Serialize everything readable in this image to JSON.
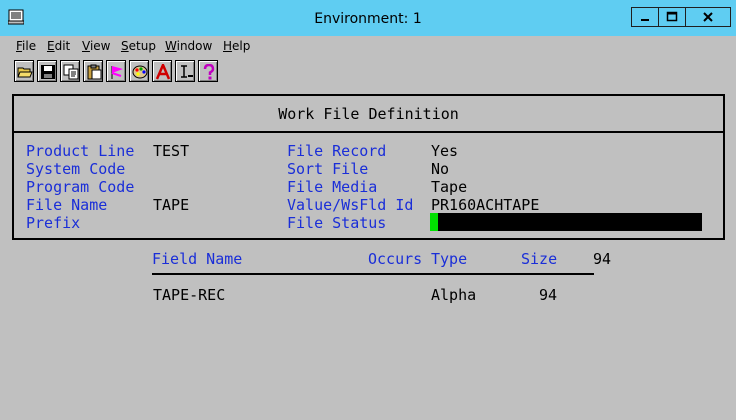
{
  "window": {
    "title": "Environment: 1"
  },
  "menu": [
    "File",
    "Edit",
    "View",
    "Setup",
    "Window",
    "Help"
  ],
  "toolbar": {
    "buttons": [
      "open-icon",
      "save-icon",
      "copy-icon",
      "paste-icon",
      "flag-icon",
      "palette-icon",
      "font-icon",
      "cursor-text-icon",
      "help-icon"
    ]
  },
  "panel": {
    "title": "Work File Definition",
    "left": [
      {
        "label": "Product Line",
        "value": "TEST"
      },
      {
        "label": "System Code",
        "value": ""
      },
      {
        "label": "Program Code",
        "value": ""
      },
      {
        "label": "File Name",
        "value": "TAPE"
      },
      {
        "label": "Prefix",
        "value": ""
      }
    ],
    "right": [
      {
        "label": "File Record",
        "value": "Yes"
      },
      {
        "label": "Sort File",
        "value": "No"
      },
      {
        "label": "File Media",
        "value": "Tape"
      },
      {
        "label": "Value/WsFld Id",
        "value": "PR160ACHTAPE"
      },
      {
        "label": "File Status",
        "value": ""
      }
    ],
    "file_status_progress": 0.03
  },
  "fields": {
    "headers": {
      "field_name": "Field Name",
      "occurs": "Occurs",
      "type": "Type",
      "size": "Size",
      "total": "94"
    },
    "rows": [
      {
        "field_name": "TAPE-REC",
        "occurs": "",
        "type": "Alpha",
        "size": "94"
      }
    ]
  },
  "colors": {
    "titlebar": "#5fcdf2",
    "label": "#1a2ed8",
    "status_fill": "#00e000"
  }
}
